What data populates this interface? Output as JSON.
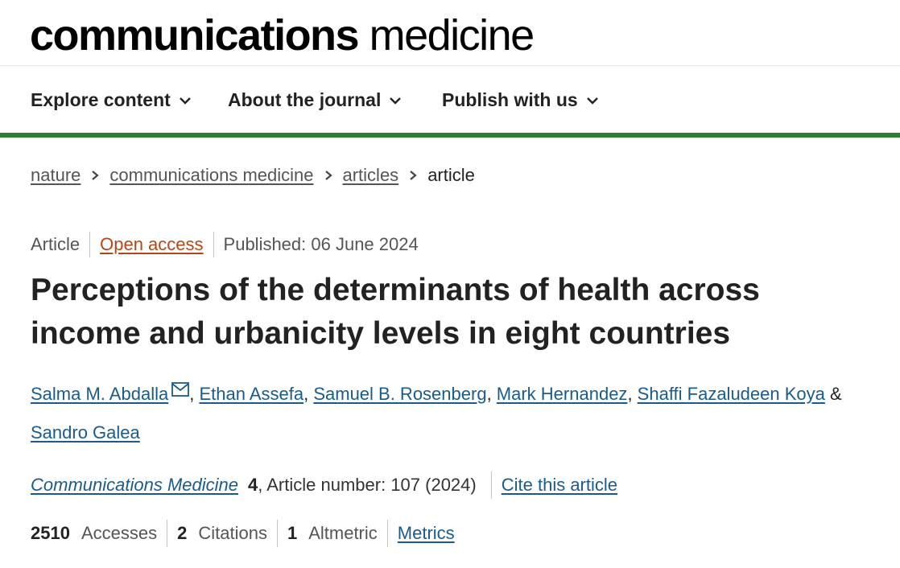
{
  "brand": {
    "name_bold": "communications",
    "name_light": "medicine"
  },
  "nav": {
    "items": [
      {
        "label": "Explore content",
        "icon": "chevron-down-icon"
      },
      {
        "label": "About the journal",
        "icon": "chevron-down-icon"
      },
      {
        "label": "Publish with us",
        "icon": "chevron-down-icon"
      }
    ],
    "accent_color": "#2e7d32"
  },
  "breadcrumb": {
    "items": [
      "nature",
      "communications medicine",
      "articles"
    ],
    "current": "article",
    "separator_icon": "chevron-right-icon"
  },
  "article": {
    "type": "Article",
    "access": "Open access",
    "published": "Published: 06 June 2024",
    "title": "Perceptions of the determinants of health across income and urbanicity levels in eight countries",
    "authors": [
      "Salma M. Abdalla",
      "Ethan Assefa",
      "Samuel B. Rosenberg",
      "Mark Hernandez",
      "Shaffi Fazaludeen Koya",
      "Sandro Galea"
    ],
    "corresponding_icon": "mail-icon",
    "journal": "Communications Medicine",
    "volume": "4",
    "article_number_text": ", Article number: 107 (2024)",
    "cite_label": "Cite this article"
  },
  "metrics": {
    "accesses_count": "2510",
    "accesses_label": "Accesses",
    "citations_count": "2",
    "citations_label": "Citations",
    "altmetric_count": "1",
    "altmetric_label": "Altmetric",
    "metrics_link": "Metrics"
  },
  "colors": {
    "link": "#1a5b8c",
    "open_access": "#b74616"
  }
}
